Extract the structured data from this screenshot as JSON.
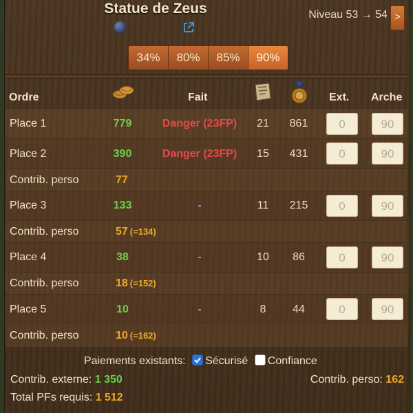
{
  "header": {
    "title": "Statue de Zeus",
    "level_text": "Niveau 53 → 54",
    "next_label": ">"
  },
  "percent_buttons": [
    "34%",
    "80%",
    "85%",
    "90%"
  ],
  "active_percent_index": 3,
  "columns": {
    "order": "Ordre",
    "done": "Fait",
    "ext": "Ext.",
    "arche": "Arche"
  },
  "icons": [
    "link-orb-icon",
    "external-link-icon",
    "forge-points-coins-icon",
    "blueprint-icon",
    "medal-icon"
  ],
  "places": [
    {
      "label": "Place 1",
      "fp": "779",
      "fait": "Danger (23FP)",
      "bp": "21",
      "medals": "861",
      "ext": "0",
      "arche": "90"
    },
    {
      "label": "Place 2",
      "fp": "390",
      "fait": "Danger (23FP)",
      "bp": "15",
      "medals": "431",
      "ext": "0",
      "arche": "90"
    },
    {
      "label": "Place 3",
      "fp": "133",
      "fait": "-",
      "bp": "11",
      "medals": "215",
      "ext": "0",
      "arche": "90"
    },
    {
      "label": "Place 4",
      "fp": "38",
      "fait": "-",
      "bp": "10",
      "medals": "86",
      "ext": "0",
      "arche": "90"
    },
    {
      "label": "Place 5",
      "fp": "10",
      "fait": "-",
      "bp": "8",
      "medals": "44",
      "ext": "0",
      "arche": "90"
    }
  ],
  "contribs": [
    {
      "label": "Contrib. perso",
      "value": "77",
      "eq": ""
    },
    {
      "label": "Contrib. perso",
      "value": "57",
      "eq": "(=134)"
    },
    {
      "label": "Contrib. perso",
      "value": "18",
      "eq": "(=152)"
    },
    {
      "label": "Contrib. perso",
      "value": "10",
      "eq": "(=162)"
    }
  ],
  "footer": {
    "payments_label": "Paiements existants:",
    "secure_label": "Sécurisé",
    "secure_checked": true,
    "trust_label": "Confiance",
    "trust_checked": false,
    "external_label": "Contrib. externe:",
    "external_value": "1 350",
    "personal_label": "Contrib. perso:",
    "personal_value": "162",
    "total_label": "Total PFs requis:",
    "total_value": "1 512"
  },
  "colors": {
    "accent_orange": "#d07a3a",
    "fp_green": "#6ad04c",
    "danger_red": "#e7484a",
    "contrib_orange": "#f0a826",
    "checkbox_blue": "#2b74d6"
  }
}
